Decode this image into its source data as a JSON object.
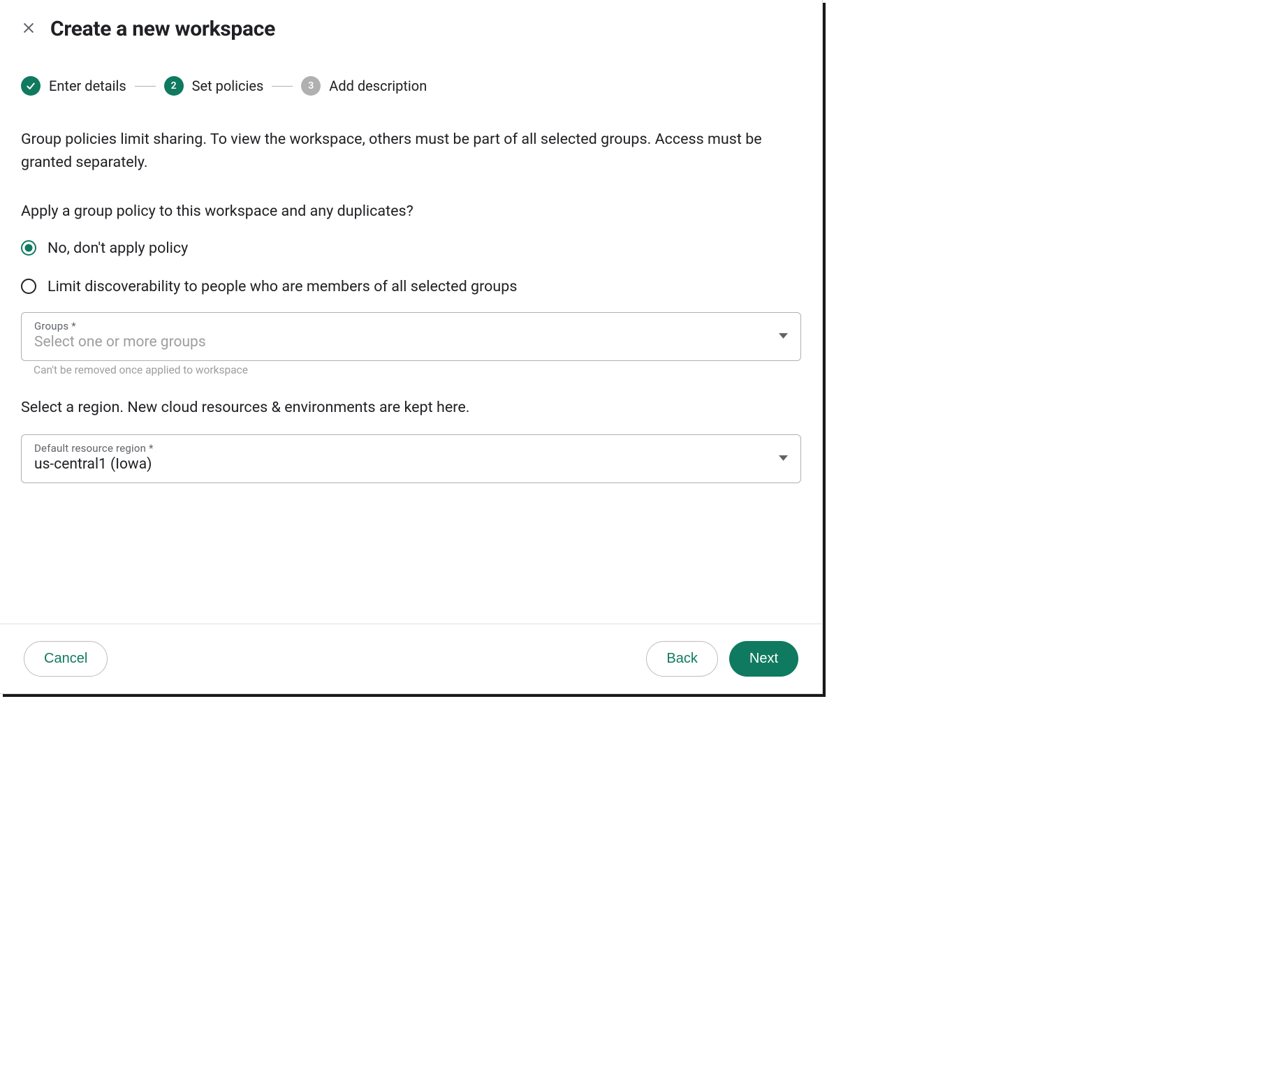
{
  "header": {
    "title": "Create a new workspace"
  },
  "stepper": {
    "steps": [
      {
        "label": "Enter details",
        "state": "completed"
      },
      {
        "label": "Set policies",
        "number": "2",
        "state": "active"
      },
      {
        "label": "Add description",
        "number": "3",
        "state": "pending"
      }
    ]
  },
  "policies": {
    "description": "Group policies limit sharing. To view the workspace, others must be part of all selected groups. Access must be granted separately.",
    "question": "Apply a group policy to this workspace and any duplicates?",
    "options": {
      "none": "No, don't apply policy",
      "limit": "Limit discoverability to people who are members of all selected groups"
    },
    "groups_select": {
      "label": "Groups *",
      "placeholder": "Select one or more groups",
      "helper": "Can't be removed once applied to workspace"
    }
  },
  "region": {
    "prompt": "Select a region. New cloud resources & environments are kept here.",
    "label": "Default resource region *",
    "value": "us-central1 (Iowa)"
  },
  "footer": {
    "cancel": "Cancel",
    "back": "Back",
    "next": "Next"
  }
}
